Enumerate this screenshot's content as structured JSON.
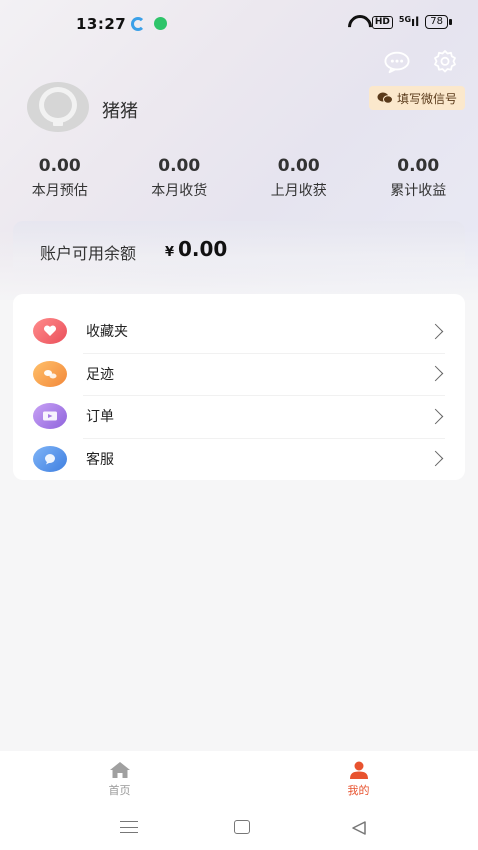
{
  "status_bar": {
    "time": "13:27",
    "hd": "HD",
    "signal": "5G",
    "battery": "78"
  },
  "header": {
    "wechat_button": "填写微信号",
    "message_icon": "chat-bubble-icon",
    "settings_icon": "gear-icon"
  },
  "profile": {
    "username": "猪猪"
  },
  "stats": [
    {
      "value": "0.00",
      "label": "本月预估"
    },
    {
      "value": "0.00",
      "label": "本月收货"
    },
    {
      "value": "0.00",
      "label": "上月收获"
    },
    {
      "value": "0.00",
      "label": "累计收益"
    }
  ],
  "balance": {
    "label": "账户可用余额",
    "currency": "¥",
    "amount": "0.00"
  },
  "menu": [
    {
      "label": "收藏夹",
      "icon": "heart-icon",
      "color": "#f26a6a"
    },
    {
      "label": "足迹",
      "icon": "footprint-icon",
      "color": "#f5a04a"
    },
    {
      "label": "订单",
      "icon": "order-icon",
      "color": "#a77be6"
    },
    {
      "label": "客服",
      "icon": "customer-service-icon",
      "color": "#4c8fe8"
    }
  ],
  "tabbar": {
    "home_label": "首页",
    "mine_label": "我的",
    "active_color": "#e8532f",
    "inactive_color": "#999999"
  }
}
